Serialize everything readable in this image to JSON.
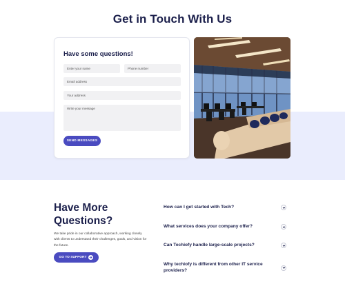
{
  "page": {
    "title": "Get in Touch With Us"
  },
  "form": {
    "heading": "Have some questions!",
    "name_placeholder": "Enter your name",
    "phone_placeholder": "Phone number",
    "email_placeholder": "Email address",
    "address_placeholder": "Your address",
    "message_placeholder": "Write your message",
    "send_label": "SEND MESSAGES"
  },
  "photo": {
    "icon": "office-photo"
  },
  "more": {
    "title": "Have More Questions?",
    "description": "We take pride in our collaborative approach, working closely with clients to understand their challenges, goals, and vision for the future.",
    "support_label": "GO TO SUPPORT"
  },
  "faq": [
    {
      "question": "How can I get started with Tech?"
    },
    {
      "question": "What services does your company offer?"
    },
    {
      "question": "Can Techiofy handle large-scale projects?"
    },
    {
      "question": "Why techiofy is different from other IT service providers?"
    }
  ],
  "colors": {
    "accent": "#4a4bc0",
    "band": "#eaedfd",
    "heading": "#1b1f4b"
  }
}
